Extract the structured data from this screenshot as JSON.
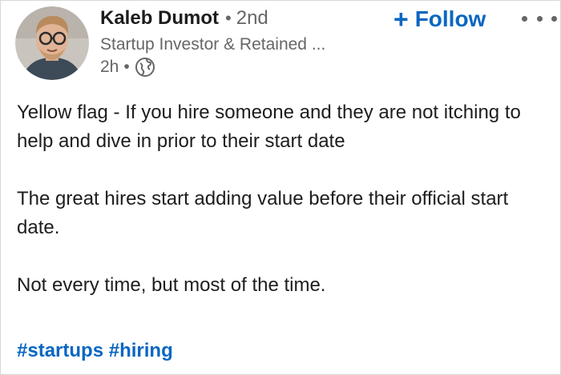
{
  "author": {
    "name": "Kaleb Dumot",
    "degree": "2nd",
    "degree_separator": "•",
    "headline": "Startup Investor & Retained ...",
    "posted_time": "2h",
    "time_separator": "•",
    "visibility_icon": "globe-icon",
    "avatar_icon": "profile-photo"
  },
  "actions": {
    "follow_plus": "+",
    "follow_label": "Follow",
    "more_icon": "ellipsis-icon"
  },
  "post": {
    "paragraphs": [
      "Yellow flag - If you hire someone and they are not itching to help and dive in prior to their start date",
      "The great hires start adding value before their official start date.",
      "Not every time, but most of the time."
    ],
    "hashtags": [
      "#startups",
      "#hiring"
    ]
  },
  "colors": {
    "link_blue": "#0a66c2",
    "text_primary": "#1d1d1d",
    "text_secondary": "#666666"
  }
}
